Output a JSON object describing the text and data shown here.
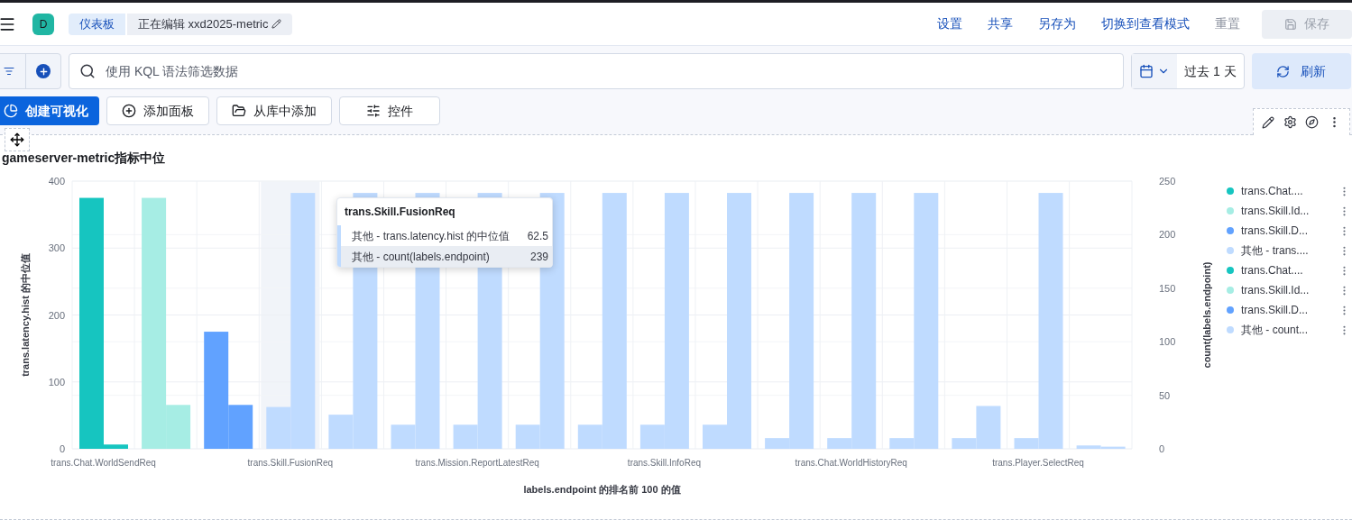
{
  "header": {
    "avatar": "D",
    "breadcrumbs": [
      {
        "label": "仪表板",
        "kind": "link"
      },
      {
        "label": "正在编辑 xxd2025-metric",
        "kind": "current"
      }
    ],
    "actions": [
      {
        "label": "设置",
        "disabled": false
      },
      {
        "label": "共享",
        "disabled": false
      },
      {
        "label": "另存为",
        "disabled": false
      },
      {
        "label": "切换到查看模式",
        "disabled": false
      },
      {
        "label": "重置",
        "disabled": true
      }
    ],
    "save_button": {
      "label": "保存",
      "disabled": true
    }
  },
  "query_bar": {
    "search": {
      "placeholder": "使用 KQL 语法筛选数据"
    },
    "time_range": "过去 1 天",
    "refresh_button": "刷新"
  },
  "toolbar": [
    {
      "label": "创建可视化",
      "kind": "primary"
    },
    {
      "label": "添加面板",
      "kind": "add"
    },
    {
      "label": "从库中添加",
      "kind": "library"
    },
    {
      "label": "控件",
      "kind": "controls"
    }
  ],
  "panel": {
    "title": "gameserver-metric指标中位",
    "chart_data": {
      "type": "bar",
      "xlabel": "labels.endpoint 的排名前 100 的值",
      "ylabel": "trans.latency.hist 的中位值",
      "categories": [
        "trans.Chat.WorldSendReq",
        null,
        null,
        "trans.Skill.FusionReq",
        null,
        null,
        "trans.Mission.ReportLatestReq",
        null,
        null,
        "trans.Skill.InfoReq",
        null,
        null,
        "trans.Chat.WorldHistoryReq",
        null,
        null,
        "trans.Player.SelectReq",
        null
      ],
      "ylim": [
        0,
        400
      ],
      "yticks": [
        0,
        100,
        200,
        300,
        400
      ],
      "stacked": false,
      "grid": true,
      "bands": [
        {
          "axis": "x",
          "from": "trans.Skill.FusionReq",
          "to": "trans.Skill.FusionReq",
          "color": "#f1f4f9"
        }
      ],
      "y2label": "count(labels.endpoint)",
      "y2lim": [
        0,
        250
      ],
      "y2ticks": [
        250,
        200,
        150,
        100,
        50,
        0
      ],
      "series": [
        {
          "name": "trans.Chat....",
          "color": "#16c5c0",
          "values": [
            375,
            null,
            null,
            null,
            null,
            null,
            null,
            null,
            null,
            null,
            null,
            null,
            null,
            null,
            null,
            null,
            null
          ]
        },
        {
          "name": "trans.Skill.Id...",
          "color": "#a6ede4",
          "values": [
            null,
            375,
            null,
            null,
            null,
            null,
            null,
            null,
            null,
            null,
            null,
            null,
            null,
            null,
            null,
            null,
            null
          ]
        },
        {
          "name": "trans.Skill.D...",
          "color": "#61a2ff",
          "values": [
            null,
            null,
            175,
            null,
            null,
            null,
            null,
            null,
            null,
            null,
            null,
            null,
            null,
            null,
            null,
            null,
            null
          ]
        },
        {
          "name": "其他 - trans....",
          "color": "#bfdbff",
          "values": [
            null,
            null,
            null,
            62.5,
            51,
            36,
            36,
            36,
            36,
            36,
            36,
            16,
            16,
            16,
            16,
            16,
            5
          ]
        },
        {
          "name": "trans.Chat....",
          "color": "#16c5c0",
          "axis": "y2",
          "values": [
            4,
            null,
            null,
            null,
            null,
            null,
            null,
            null,
            null,
            null,
            null,
            null,
            null,
            null,
            null,
            null,
            null
          ]
        },
        {
          "name": "trans.Skill.Id...",
          "color": "#a6ede4",
          "axis": "y2",
          "values": [
            null,
            41,
            null,
            null,
            null,
            null,
            null,
            null,
            null,
            null,
            null,
            null,
            null,
            null,
            null,
            null,
            null
          ]
        },
        {
          "name": "trans.Skill.D...",
          "color": "#61a2ff",
          "axis": "y2",
          "values": [
            null,
            null,
            41,
            null,
            null,
            null,
            null,
            null,
            null,
            null,
            null,
            null,
            null,
            null,
            null,
            null,
            null
          ]
        },
        {
          "name": "其他 - count...",
          "color": "#bfdbff",
          "axis": "y2",
          "values": [
            null,
            null,
            null,
            239,
            239,
            239,
            239,
            239,
            239,
            239,
            239,
            239,
            239,
            239,
            40,
            239,
            2
          ]
        }
      ]
    },
    "tooltip": {
      "title": "trans.Skill.FusionReq",
      "rows": [
        {
          "label": "其他 - trans.latency.hist 的中位值",
          "value": "62.5",
          "color": "#bfdbff",
          "selected": false
        },
        {
          "label": "其他 - count(labels.endpoint)",
          "value": "239",
          "color": "#bfdbff",
          "selected": true
        }
      ]
    }
  }
}
